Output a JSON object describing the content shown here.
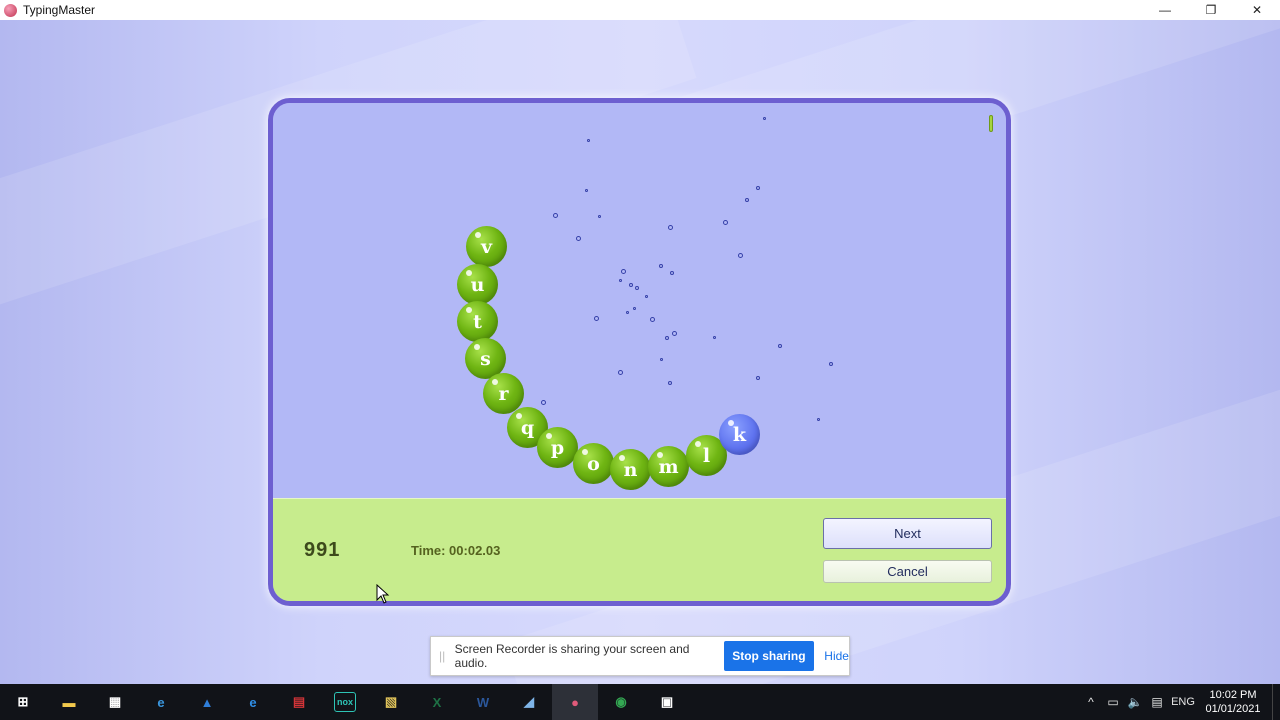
{
  "window": {
    "title": "TypingMaster",
    "controls": {
      "minimize": "—",
      "restore": "❐",
      "close": "✕"
    }
  },
  "game": {
    "letters": [
      "v",
      "u",
      "t",
      "s",
      "r",
      "q",
      "p",
      "o",
      "n",
      "m",
      "l",
      "k"
    ],
    "active_letter": "k",
    "score": "991",
    "time": "Time: 00:02.03",
    "next_label": "Next",
    "cancel_label": "Cancel"
  },
  "sharing_bar": {
    "grip": "||",
    "message": "Screen Recorder is sharing your screen and audio.",
    "stop_label": "Stop sharing",
    "hide_label": "Hide"
  },
  "taskbar": {
    "apps": [
      {
        "name": "start-icon",
        "glyph": "⊞",
        "color": "#ffffff"
      },
      {
        "name": "file-explorer-icon",
        "glyph": "▬",
        "color": "#f2c94c"
      },
      {
        "name": "store-icon",
        "glyph": "▦",
        "color": "#ffffff"
      },
      {
        "name": "internet-explorer-icon",
        "glyph": "e",
        "color": "#3a96dd"
      },
      {
        "name": "azure-icon",
        "glyph": "▲",
        "color": "#2f7ed8"
      },
      {
        "name": "edge-icon",
        "glyph": "e",
        "color": "#2f8ee5"
      },
      {
        "name": "calendar-app-icon",
        "glyph": "▤",
        "color": "#d13438"
      },
      {
        "name": "nox-icon",
        "glyph": "nox",
        "color": "#2ec4b6"
      },
      {
        "name": "python-file-icon",
        "glyph": "▧",
        "color": "#e0c35a"
      },
      {
        "name": "excel-icon",
        "glyph": "X",
        "color": "#1e7145"
      },
      {
        "name": "word-icon",
        "glyph": "W",
        "color": "#2b579a"
      },
      {
        "name": "notes-icon",
        "glyph": "◢",
        "color": "#7fb5e8"
      },
      {
        "name": "typingmaster-icon",
        "glyph": "●",
        "color": "#e05a7a"
      },
      {
        "name": "chrome-icon",
        "glyph": "◉",
        "color": "#34a853"
      },
      {
        "name": "screen-recorder-icon",
        "glyph": "▣",
        "color": "#ffffff"
      }
    ],
    "tray": {
      "chevron": "^",
      "network": "▭",
      "volume": "🔈",
      "notifications": "▤",
      "language": "ENG",
      "time": "10:02 PM",
      "date": "01/01/2021"
    }
  }
}
